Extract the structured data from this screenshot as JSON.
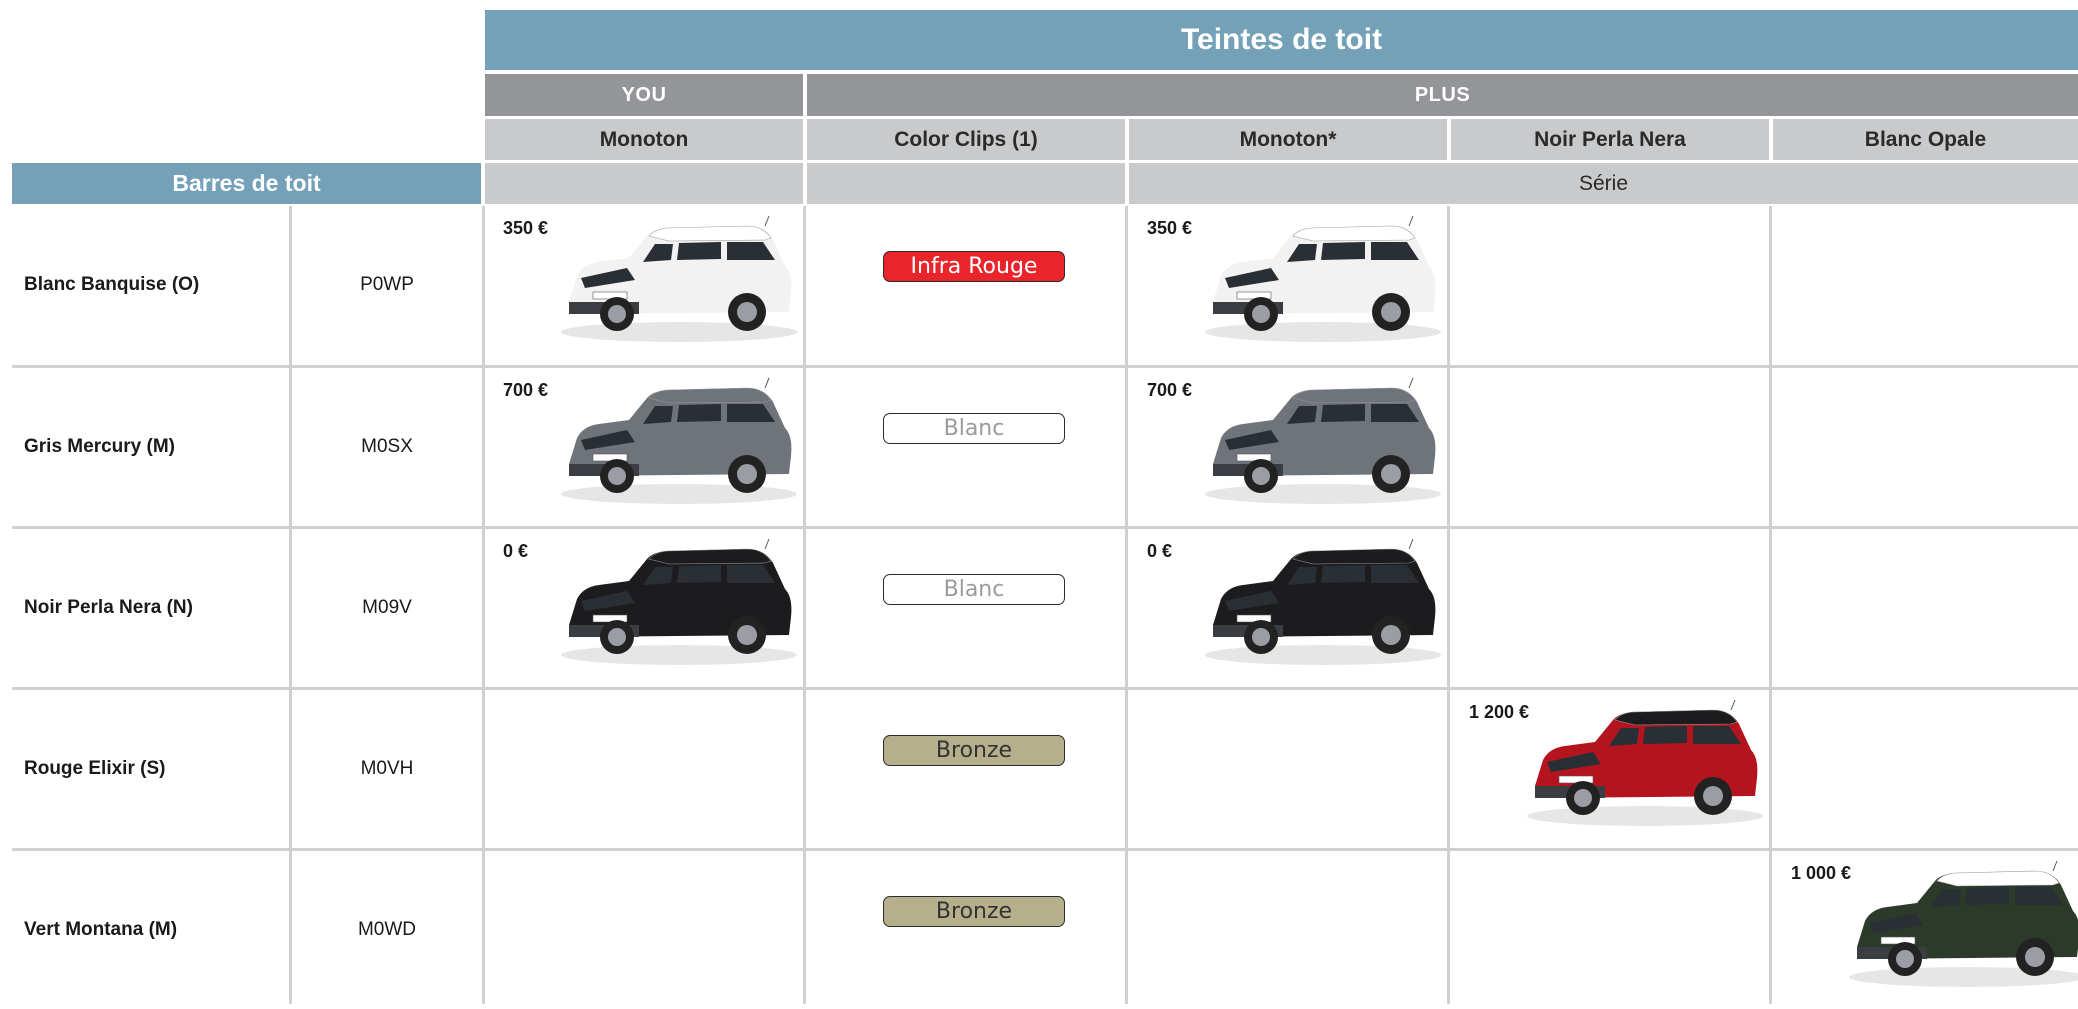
{
  "title": "Teintes de toit",
  "groups": {
    "you": "YOU",
    "plus": "PLUS"
  },
  "columns": [
    "Monoton",
    "Color Clips (1)",
    "Monoton*",
    "Noir Perla Nera",
    "Blanc Opale"
  ],
  "serie": "Série",
  "barres_label": "Barres de toit",
  "colors": {
    "header_blue": "#74a1b8",
    "header_grey": "#939598",
    "header_light": "#c9cacc",
    "clip_red": "#e9242a",
    "clip_bronze": "#b5b08b"
  },
  "rows": [
    {
      "name": "Blanc Banquise (O)",
      "code": "P0WP",
      "you_price": "350 €",
      "clip": "Infra Rouge",
      "plus_price": "350 €",
      "noir_price": "",
      "blanc_price": "",
      "body_color": "#f2f2f2",
      "roof_color": "#ffffff"
    },
    {
      "name": "Gris Mercury (M)",
      "code": "M0SX",
      "you_price": "700 €",
      "clip": "Blanc",
      "plus_price": "700 €",
      "noir_price": "",
      "blanc_price": "",
      "body_color": "#6f747b",
      "roof_color": "#6f747b"
    },
    {
      "name": "Noir Perla Nera (N)",
      "code": "M09V",
      "you_price": "0 €",
      "clip": "Blanc",
      "plus_price": "0 €",
      "noir_price": "",
      "blanc_price": "",
      "body_color": "#1c1c1e",
      "roof_color": "#1c1c1e"
    },
    {
      "name": "Rouge Elixir (S)",
      "code": "M0VH",
      "you_price": "",
      "clip": "Bronze",
      "plus_price": "",
      "noir_price": "1 200 €",
      "blanc_price": "",
      "body_color": "#b3141d",
      "roof_color": "#1c1c1e"
    },
    {
      "name": "Vert Montana (M)",
      "code": "M0WD",
      "you_price": "",
      "clip": "Bronze",
      "plus_price": "",
      "noir_price": "",
      "blanc_price": "1 000 €",
      "body_color": "#2c3a2a",
      "roof_color": "#ffffff"
    }
  ]
}
